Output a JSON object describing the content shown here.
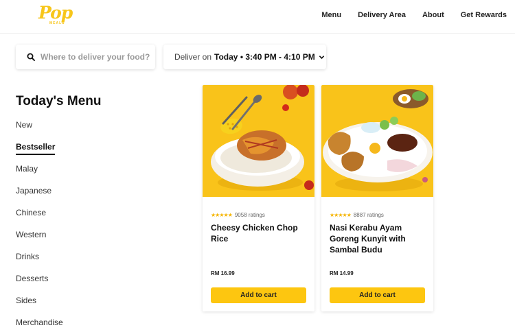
{
  "brand": {
    "logo_text": "Pop",
    "logo_subtext": "MEALS",
    "color": "#f7c61b"
  },
  "nav": [
    "Menu",
    "Delivery Area",
    "About",
    "Get Rewards"
  ],
  "search": {
    "placeholder": "Where to deliver your food?",
    "value": "",
    "icon": "search-icon"
  },
  "delivery": {
    "prefix": "Deliver on",
    "value": "Today • 3:40 PM - 4:10 PM",
    "icon": "chevron-down-icon"
  },
  "menu": {
    "title": "Today's Menu",
    "active": "Bestseller",
    "items": [
      "New",
      "Bestseller",
      "Malay",
      "Japanese",
      "Chinese",
      "Western",
      "Drinks",
      "Desserts",
      "Sides",
      "Merchandise"
    ]
  },
  "products": [
    {
      "name": "Cheesy Chicken Chop Rice",
      "stars": "★★★★★",
      "ratings": "9058 ratings",
      "price": "RM 16.99",
      "button": "Add to cart"
    },
    {
      "name": "Nasi Kerabu Ayam Goreng Kunyit with Sambal Budu",
      "stars": "★★★★★",
      "ratings": "8887 ratings",
      "price": "RM 14.99",
      "button": "Add to cart"
    }
  ],
  "colors": {
    "accent": "#fdc610",
    "image_bg": "#f9c31a",
    "star": "#f5b400"
  }
}
